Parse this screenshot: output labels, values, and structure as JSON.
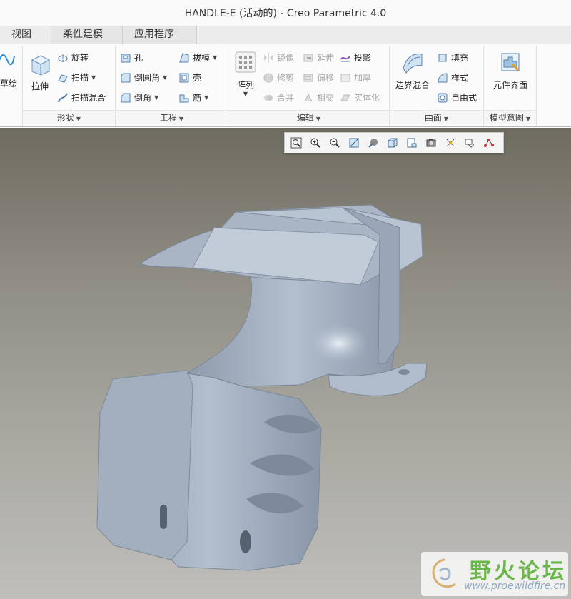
{
  "window": {
    "title": "HANDLE-E (活动的) - Creo Parametric 4.0"
  },
  "tabs": [
    {
      "label": "视图"
    },
    {
      "label": "柔性建模"
    },
    {
      "label": "应用程序"
    }
  ],
  "ribbon": {
    "sketch": {
      "label": "草绘"
    },
    "shapes": {
      "label": "形状",
      "extrude": "拉伸",
      "revolve": "旋转",
      "sweep": "扫描",
      "swept_blend": "扫描混合"
    },
    "engineering": {
      "label": "工程",
      "hole": "孔",
      "round": "倒圆角",
      "chamfer": "倒角",
      "draft": "拔模",
      "shell": "壳",
      "rib": "筋"
    },
    "editing": {
      "label": "编辑",
      "pattern": "阵列",
      "mirror": "镜像",
      "trim": "修剪",
      "merge": "合并",
      "extend": "延伸",
      "offset": "偏移",
      "intersect": "相交",
      "project": "投影",
      "thicken": "加厚",
      "solidify": "实体化"
    },
    "surfaces": {
      "label": "曲面",
      "boundary_blend": "边界混合",
      "fill": "填充",
      "style": "样式",
      "freestyle": "自由式"
    },
    "model_intent": {
      "label": "模型意图",
      "component_interface": "元件界面"
    }
  },
  "view_toolbar": {
    "icons": [
      "refit-icon",
      "zoom-in-icon",
      "zoom-out-icon",
      "repaint-icon",
      "display-style-icon",
      "saved-orientations-icon",
      "named-views-icon",
      "view-manager-icon",
      "datum-display-icon",
      "annotation-display-icon",
      "spin-center-icon"
    ]
  },
  "watermark": {
    "text": "野火论坛",
    "url": "www.proewildfire.cn"
  },
  "colors": {
    "model": "#a7b4c6",
    "viewport_top": "#6e6b60",
    "viewport_bottom": "#bfbebb"
  }
}
